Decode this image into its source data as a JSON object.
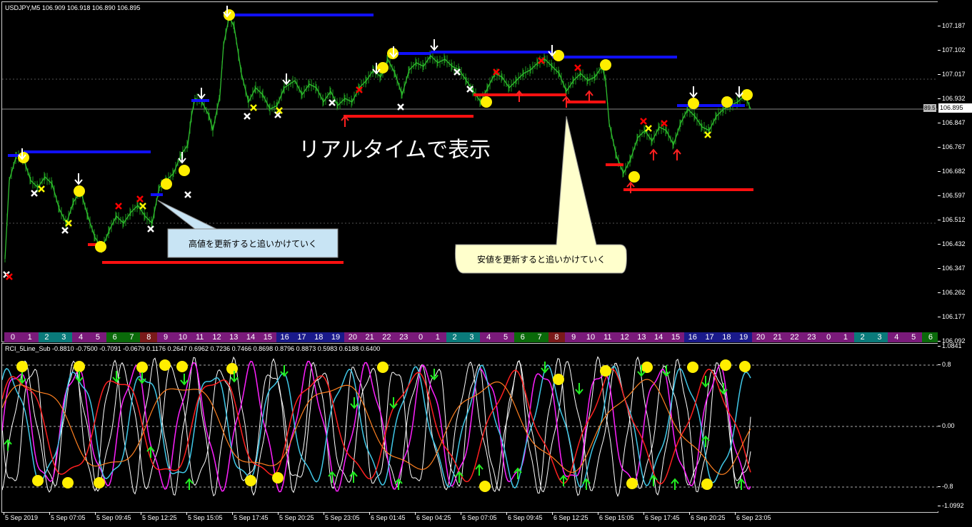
{
  "main_chart": {
    "title": "USDJPY,M5  106.909 106.918 106.890 106.895",
    "current_price": "106.895",
    "current_price_left": "89.5",
    "price_labels": [
      "107.187",
      "107.102",
      "107.017",
      "106.932",
      "106.847",
      "106.767",
      "106.682",
      "106.597",
      "106.512",
      "106.432",
      "106.347",
      "106.262",
      "106.177",
      "106.092"
    ],
    "annotation_title": "リアルタイムで表示",
    "callout_high": "高値を更新すると追いかけていく",
    "callout_low": "安値を更新すると追いかけていく",
    "hour_labels": [
      "0",
      "1",
      "2",
      "3",
      "4",
      "5",
      "6",
      "7",
      "8",
      "9",
      "10",
      "11",
      "12",
      "13",
      "14",
      "15",
      "16",
      "17",
      "18",
      "19",
      "20",
      "21",
      "22",
      "23",
      "0",
      "1",
      "2",
      "3",
      "4",
      "5",
      "6",
      "7",
      "8",
      "9",
      "10",
      "11",
      "12",
      "13",
      "14",
      "15",
      "16",
      "17",
      "18",
      "19",
      "20",
      "21",
      "22",
      "23",
      "0",
      "1",
      "2",
      "3",
      "4",
      "5",
      "6"
    ],
    "hour_colors": [
      "#7a1a7a",
      "#7a1a7a",
      "#0a7a7a",
      "#0a7a7a",
      "#7a1a7a",
      "#7a1a7a",
      "#0a6a0a",
      "#0a6a0a",
      "#7a1a1a",
      "#7a1a7a",
      "#7a1a7a",
      "#7a1a7a",
      "#7a1a7a",
      "#7a1a7a",
      "#7a1a7a",
      "#7a1a7a",
      "#1a1a8a",
      "#1a1a8a",
      "#1a1a8a",
      "#1a1a8a",
      "#7a1a7a",
      "#7a1a7a",
      "#7a1a7a",
      "#7a1a7a",
      "#7a1a7a",
      "#7a1a7a",
      "#0a7a7a",
      "#0a7a7a",
      "#7a1a7a",
      "#7a1a7a",
      "#0a6a0a",
      "#0a6a0a",
      "#7a1a1a",
      "#7a1a7a",
      "#7a1a7a",
      "#7a1a7a",
      "#7a1a7a",
      "#7a1a7a",
      "#7a1a7a",
      "#7a1a7a",
      "#1a1a8a",
      "#1a1a8a",
      "#1a1a8a",
      "#1a1a8a",
      "#7a1a7a",
      "#7a1a7a",
      "#7a1a7a",
      "#7a1a7a",
      "#7a1a7a",
      "#7a1a7a",
      "#0a7a7a",
      "#0a7a7a",
      "#7a1a7a",
      "#7a1a7a",
      "#0a6a0a"
    ]
  },
  "sub_chart": {
    "title": "RCI_5Line_Sub  -0.8810 -0.7500 -0.7091 -0.0679 0.1176 0.2647 0.6962 0.7236 0.7466 0.8698 0.8796 0.8873 0.5983 0.6188 0.6400",
    "levels": [
      "1.0841",
      "0.8",
      "0.00",
      "-0.8",
      "-1.0992"
    ]
  },
  "time_labels": [
    "5 Sep 2019",
    "5 Sep 07:05",
    "5 Sep 09:45",
    "5 Sep 12:25",
    "5 Sep 15:05",
    "5 Sep 17:45",
    "5 Sep 20:25",
    "5 Sep 23:05",
    "6 Sep 01:45",
    "6 Sep 04:25",
    "6 Sep 07:05",
    "6 Sep 09:45",
    "6 Sep 12:25",
    "6 Sep 15:05",
    "6 Sep 17:45",
    "6 Sep 20:25",
    "6 Sep 23:05"
  ],
  "colors": {
    "candles": "#22aa22",
    "high_line": "#0000ff",
    "low_line": "#ff0000",
    "callout_high_bg": "#c8e4f4",
    "callout_low_bg": "#ffffcc",
    "signal_yellow": "#ffff00",
    "rci_white": "#ffffff",
    "rci_magenta": "#ff00ff",
    "rci_cyan": "#40c0e0",
    "rci_red": "#ff2020",
    "rci_orange": "#ff8020"
  }
}
